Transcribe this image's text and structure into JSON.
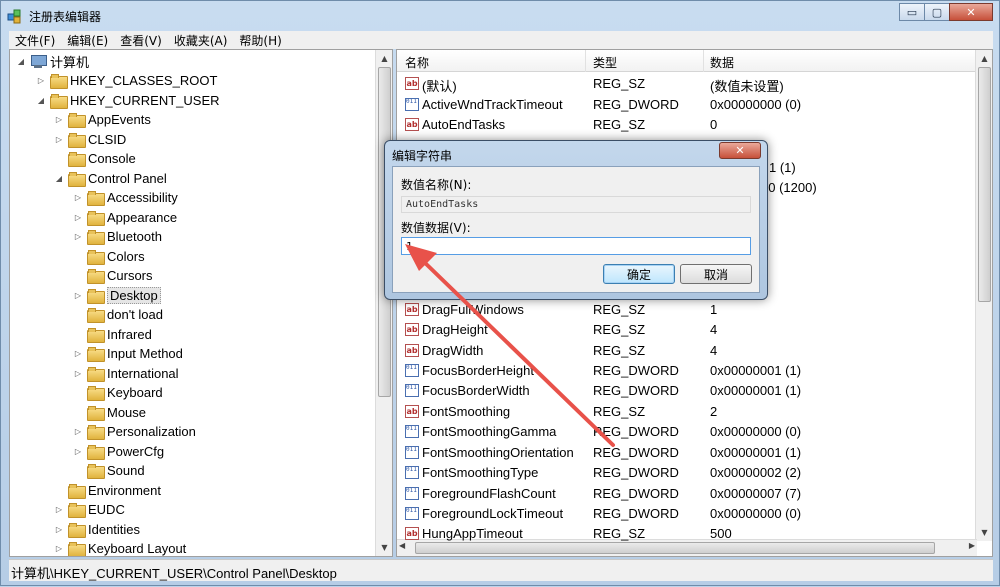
{
  "window": {
    "title": "注册表编辑器",
    "controls": {
      "minimize": "▭",
      "maximize": "▢",
      "close": "✕"
    }
  },
  "menu": [
    "文件(F)",
    "编辑(E)",
    "查看(V)",
    "收藏夹(A)",
    "帮助(H)"
  ],
  "tree": {
    "root": "计算机",
    "hkcr": "HKEY_CLASSES_ROOT",
    "hkcu": "HKEY_CURRENT_USER",
    "hkcu_children": [
      "AppEvents",
      "CLSID",
      "Console",
      "Control Panel"
    ],
    "control_panel_children": [
      "Accessibility",
      "Appearance",
      "Bluetooth",
      "Colors",
      "Cursors",
      "Desktop",
      "don't load",
      "Infrared",
      "Input Method",
      "International",
      "Keyboard",
      "Mouse",
      "Personalization",
      "PowerCfg",
      "Sound"
    ],
    "hkcu_after": [
      "Environment",
      "EUDC",
      "Identities",
      "Keyboard Layout"
    ]
  },
  "list": {
    "headers": {
      "name": "名称",
      "type": "类型",
      "data": "数据"
    },
    "rows": [
      {
        "icon": "ab",
        "name": "(默认)",
        "type": "REG_SZ",
        "data": "(数值未设置)"
      },
      {
        "icon": "bin",
        "name": "ActiveWndTrackTimeout",
        "type": "REG_DWORD",
        "data": "0x00000000 (0)"
      },
      {
        "icon": "ab",
        "name": "AutoEndTasks",
        "type": "REG_SZ",
        "data": "0"
      },
      {
        "icon": "ab",
        "name": "DragFullWindows",
        "type": "REG_SZ",
        "data": "1"
      },
      {
        "icon": "ab",
        "name": "DragHeight",
        "type": "REG_SZ",
        "data": "4"
      },
      {
        "icon": "ab",
        "name": "DragWidth",
        "type": "REG_SZ",
        "data": "4"
      },
      {
        "icon": "bin",
        "name": "FocusBorderHeight",
        "type": "REG_DWORD",
        "data": "0x00000001 (1)"
      },
      {
        "icon": "bin",
        "name": "FocusBorderWidth",
        "type": "REG_DWORD",
        "data": "0x00000001 (1)"
      },
      {
        "icon": "ab",
        "name": "FontSmoothing",
        "type": "REG_SZ",
        "data": "2"
      },
      {
        "icon": "bin",
        "name": "FontSmoothingGamma",
        "type": "REG_DWORD",
        "data": "0x00000000 (0)"
      },
      {
        "icon": "bin",
        "name": "FontSmoothingOrientation",
        "type": "REG_DWORD",
        "data": "0x00000001 (1)"
      },
      {
        "icon": "bin",
        "name": "FontSmoothingType",
        "type": "REG_DWORD",
        "data": "0x00000002 (2)"
      },
      {
        "icon": "bin",
        "name": "ForegroundFlashCount",
        "type": "REG_DWORD",
        "data": "0x00000007 (7)"
      },
      {
        "icon": "bin",
        "name": "ForegroundLockTimeout",
        "type": "REG_DWORD",
        "data": "0x00000000 (0)"
      },
      {
        "icon": "ab",
        "name": "HungAppTimeout",
        "type": "REG_SZ",
        "data": "500"
      }
    ],
    "partial_data": {
      "a": "1 (1)",
      "b": "60 (1200)"
    }
  },
  "statusbar": {
    "path": "计算机\\HKEY_CURRENT_USER\\Control Panel\\Desktop"
  },
  "dialog": {
    "title": "编辑字符串",
    "close": "✕",
    "name_label": "数值名称(N):",
    "name_value": "AutoEndTasks",
    "data_label": "数值数据(V):",
    "data_value": "1",
    "ok": "确定",
    "cancel": "取消"
  },
  "colors": {
    "annotation_arrow": "#e8524a",
    "selection": "#e5e5e5",
    "window_frame": "#b6cde6"
  },
  "icons": {
    "string_value": "ab-icon",
    "binary_value": "dword-icon",
    "folder": "folder-icon"
  }
}
